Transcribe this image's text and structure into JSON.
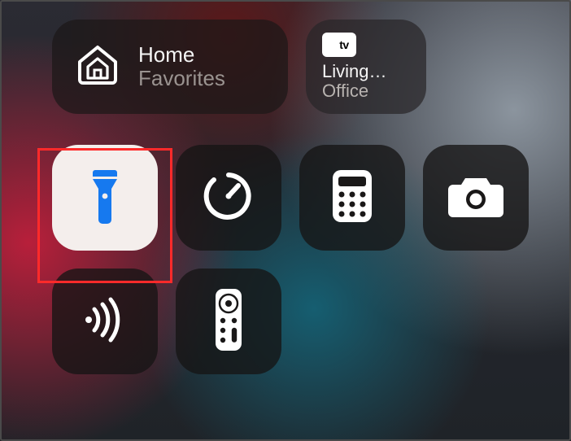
{
  "topRow": {
    "home": {
      "title": "Home",
      "subtitle": "Favorites"
    },
    "appleTv": {
      "badge": "tv",
      "line1": "Living…",
      "line2": "Office"
    }
  },
  "tiles": {
    "flashlight": {
      "name": "flashlight",
      "active": true
    },
    "timer": {
      "name": "timer"
    },
    "calculator": {
      "name": "calculator"
    },
    "camera": {
      "name": "camera"
    },
    "nfc": {
      "name": "nfc-tag-reader"
    },
    "remote": {
      "name": "apple-tv-remote"
    }
  },
  "highlight": {
    "target": "flashlight"
  }
}
